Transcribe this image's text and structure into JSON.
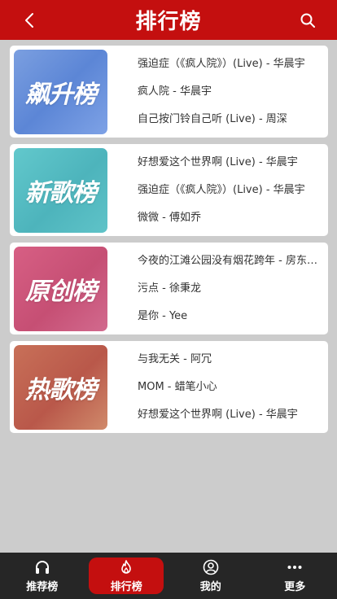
{
  "header": {
    "title": "排行榜",
    "back_icon": "chevron-left-icon",
    "search_icon": "search-icon"
  },
  "charts": [
    {
      "cover_text": "飙升榜",
      "songs": [
        "强迫症（《疯人院》）(Live) - 华晨宇",
        "疯人院 - 华晨宇",
        "自己按门铃自己听 (Live) - 周深"
      ]
    },
    {
      "cover_text": "新歌榜",
      "songs": [
        "好想爱这个世界啊 (Live) - 华晨宇",
        "强迫症（《疯人院》）(Live) - 华晨宇",
        "微微 - 傅如乔"
      ]
    },
    {
      "cover_text": "原创榜",
      "songs": [
        "今夜的江滩公园没有烟花跨年 - 房东的猫",
        "污点 - 徐秉龙",
        "是你 - Yee"
      ]
    },
    {
      "cover_text": "热歌榜",
      "songs": [
        "与我无关 - 阿冗",
        "MOM - 蜡笔小心",
        "好想爱这个世界啊 (Live) - 华晨宇"
      ]
    }
  ],
  "tabbar": {
    "items": [
      {
        "label": "推荐榜",
        "icon": "headphones-icon"
      },
      {
        "label": "排行榜",
        "icon": "flame-icon",
        "active": true
      },
      {
        "label": "我的",
        "icon": "user-icon"
      },
      {
        "label": "更多",
        "icon": "more-dots-icon"
      }
    ]
  },
  "colors": {
    "brand": "#c40f0f",
    "tabbar": "#262626",
    "background": "#cccccc"
  }
}
